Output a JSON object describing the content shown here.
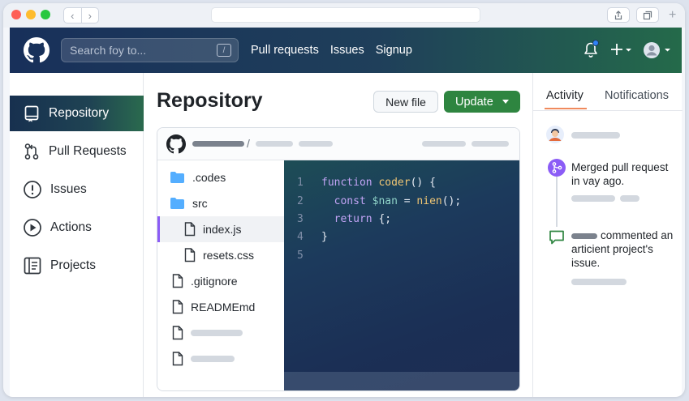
{
  "header": {
    "search_placeholder": "Search foy to...",
    "search_shortcut": "/",
    "nav": [
      "Pull requests",
      "Issues",
      "Signup"
    ]
  },
  "sidebar": {
    "items": [
      {
        "label": "Repository",
        "icon": "repo-icon",
        "active": true
      },
      {
        "label": "Pull Requests",
        "icon": "pull-request-icon",
        "active": false
      },
      {
        "label": "Issues",
        "icon": "issue-icon",
        "active": false
      },
      {
        "label": "Actions",
        "icon": "play-icon",
        "active": false
      },
      {
        "label": "Projects",
        "icon": "project-icon",
        "active": false
      }
    ]
  },
  "main": {
    "title": "Repository",
    "new_file_label": "New file",
    "update_label": "Update",
    "breadcrumb_separator": "/",
    "files": [
      {
        "name": ".codes",
        "type": "folder"
      },
      {
        "name": "src",
        "type": "folder"
      },
      {
        "name": "index.js",
        "type": "file",
        "selected": true
      },
      {
        "name": "resets.css",
        "type": "file"
      },
      {
        "name": ".gitignore",
        "type": "file"
      },
      {
        "name": "READMEmd",
        "type": "file"
      }
    ],
    "code": {
      "line_numbers": [
        "1",
        "2",
        "3",
        "4",
        "5"
      ],
      "l1_kw": "function",
      "l1_fn": "coder",
      "l1_rest": "() {",
      "l2_kw": "const",
      "l2_var": "$nan",
      "l2_op": " = ",
      "l2_fn": "nien",
      "l2_rest": "();",
      "l3_kw": "return",
      "l3_rest": " {;",
      "l4": "}"
    }
  },
  "activity": {
    "tab_activity": "Activity",
    "tab_notifications": "Notifications",
    "merged_text": "Merged pull request in vay ago.",
    "comment_text": "commented an articient project's issue."
  },
  "colors": {
    "accent_green": "#2e8540",
    "merge_purple": "#8b5cf6",
    "tab_underline": "#f08a5d",
    "notify_blue": "#2f81f7"
  }
}
